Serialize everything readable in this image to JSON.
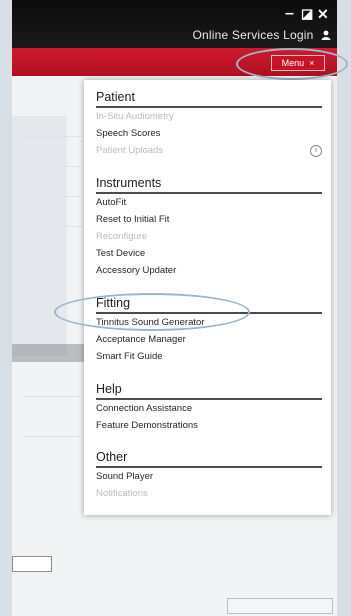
{
  "window": {
    "controls": {
      "minimize": "–",
      "restore": "◪",
      "close": "✕"
    }
  },
  "header": {
    "online_services": "Online Services Login"
  },
  "menu_button": {
    "label": "Menu",
    "close_glyph": "×"
  },
  "menu": {
    "sections": [
      {
        "title": "Patient",
        "items": [
          {
            "label": "In-Situ Audiometry",
            "enabled": false
          },
          {
            "label": "Speech Scores",
            "enabled": true
          },
          {
            "label": "Patient Uploads",
            "enabled": false
          }
        ]
      },
      {
        "title": "Instruments",
        "items": [
          {
            "label": "AutoFit",
            "enabled": true
          },
          {
            "label": "Reset to Initial Fit",
            "enabled": true
          },
          {
            "label": "Reconfigure",
            "enabled": false
          },
          {
            "label": "Test Device",
            "enabled": true
          },
          {
            "label": "Accessory Updater",
            "enabled": true
          }
        ]
      },
      {
        "title": "Fitting",
        "items": [
          {
            "label": "Tinnitus Sound Generator",
            "enabled": true
          },
          {
            "label": "Acceptance Manager",
            "enabled": true
          },
          {
            "label": "Smart Fit Guide",
            "enabled": true
          }
        ]
      },
      {
        "title": "Help",
        "items": [
          {
            "label": "Connection Assistance",
            "enabled": true
          },
          {
            "label": "Feature Demonstrations",
            "enabled": true
          }
        ]
      },
      {
        "title": "Other",
        "items": [
          {
            "label": "Sound Player",
            "enabled": true
          },
          {
            "label": "Notifications",
            "enabled": false
          }
        ]
      }
    ],
    "info_icon": "i"
  },
  "colors": {
    "accent_red": "#c61328",
    "titlebar": "#111111",
    "highlight_circle": "#9db6c8"
  }
}
